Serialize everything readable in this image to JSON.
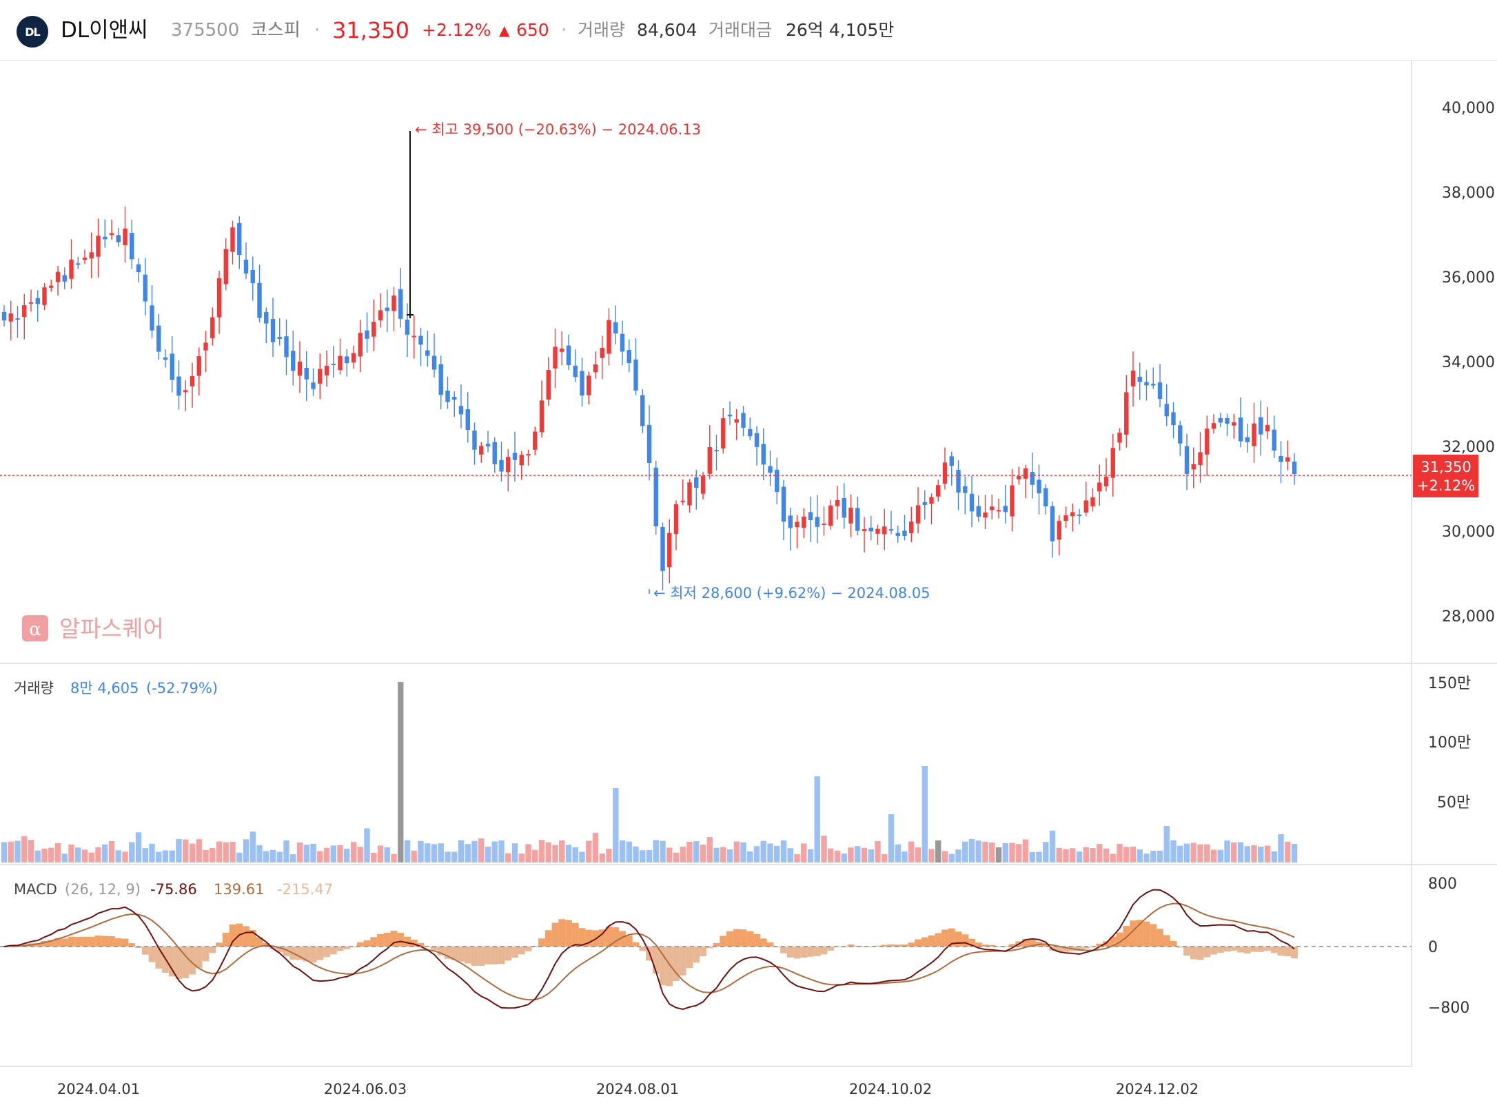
{
  "header": {
    "logo_text": "DL",
    "name": "DL이앤씨",
    "code": "375500",
    "market": "코스피",
    "price": "31,350",
    "change_pct": "+2.12%",
    "change_abs": "650",
    "volume_label": "거래량",
    "volume_value": "84,604",
    "amount_label": "거래대금",
    "amount_value": "26억 4,105만"
  },
  "colors": {
    "up": "#ef3a3a",
    "down": "#3f86e8",
    "macd": "#6e1010",
    "signal": "#b06a3c",
    "hist_up": "#f2a267",
    "hist_down": "#e8b896"
  },
  "annotations": {
    "high": "← 최고 39,500 (−20.63%) − 2024.06.13",
    "low": "← 최저 28,600 (+9.62%) − 2024.08.05"
  },
  "price_badge": {
    "price": "31,350",
    "pct": "+2.12%"
  },
  "watermark": "알파스퀘어",
  "volume_panel": {
    "label": "거래량",
    "value": "8만 4,605",
    "pct": "(-52.79%)",
    "ticks": [
      "150만",
      "100만",
      "50만"
    ]
  },
  "macd_panel": {
    "label": "MACD",
    "params": "(26, 12, 9)",
    "macd": "-75.86",
    "signal": "139.61",
    "hist": "-215.47",
    "ticks": [
      "800",
      "0",
      "−800"
    ]
  },
  "chart_data": {
    "type": "candlestick",
    "y_ticks": [
      "40,000",
      "38,000",
      "36,000",
      "34,000",
      "32,000",
      "30,000",
      "28,000"
    ],
    "y_range": [
      27000,
      41000
    ],
    "x_labels": [
      "2024.04.01",
      "2024.06.03",
      "2024.08.01",
      "2024.10.02",
      "2024.12.02"
    ],
    "last_price": 31350,
    "high": 39500,
    "low": 28600,
    "anchors": [
      [
        0,
        34900
      ],
      [
        6,
        35600
      ],
      [
        12,
        36600
      ],
      [
        18,
        37100
      ],
      [
        22,
        34800
      ],
      [
        26,
        33100
      ],
      [
        30,
        34300
      ],
      [
        34,
        37200
      ],
      [
        38,
        35200
      ],
      [
        42,
        34100
      ],
      [
        46,
        33600
      ],
      [
        50,
        34000
      ],
      [
        54,
        34600
      ],
      [
        58,
        35400
      ],
      [
        62,
        34200
      ],
      [
        66,
        33200
      ],
      [
        70,
        32100
      ],
      [
        74,
        31600
      ],
      [
        78,
        31700
      ],
      [
        82,
        34400
      ],
      [
        86,
        33200
      ],
      [
        90,
        34900
      ],
      [
        93,
        34100
      ],
      [
        96,
        31500
      ],
      [
        98,
        29100
      ],
      [
        100,
        30600
      ],
      [
        104,
        31400
      ],
      [
        108,
        32900
      ],
      [
        112,
        32100
      ],
      [
        116,
        30300
      ],
      [
        120,
        30100
      ],
      [
        124,
        30600
      ],
      [
        128,
        30100
      ],
      [
        132,
        29800
      ],
      [
        136,
        30400
      ],
      [
        140,
        31600
      ],
      [
        144,
        30500
      ],
      [
        148,
        30400
      ],
      [
        152,
        31400
      ],
      [
        156,
        30000
      ],
      [
        160,
        30500
      ],
      [
        164,
        31200
      ],
      [
        168,
        33700
      ],
      [
        172,
        33100
      ],
      [
        176,
        31500
      ],
      [
        180,
        32600
      ],
      [
        184,
        32300
      ],
      [
        188,
        32400
      ],
      [
        192,
        31300
      ]
    ]
  }
}
